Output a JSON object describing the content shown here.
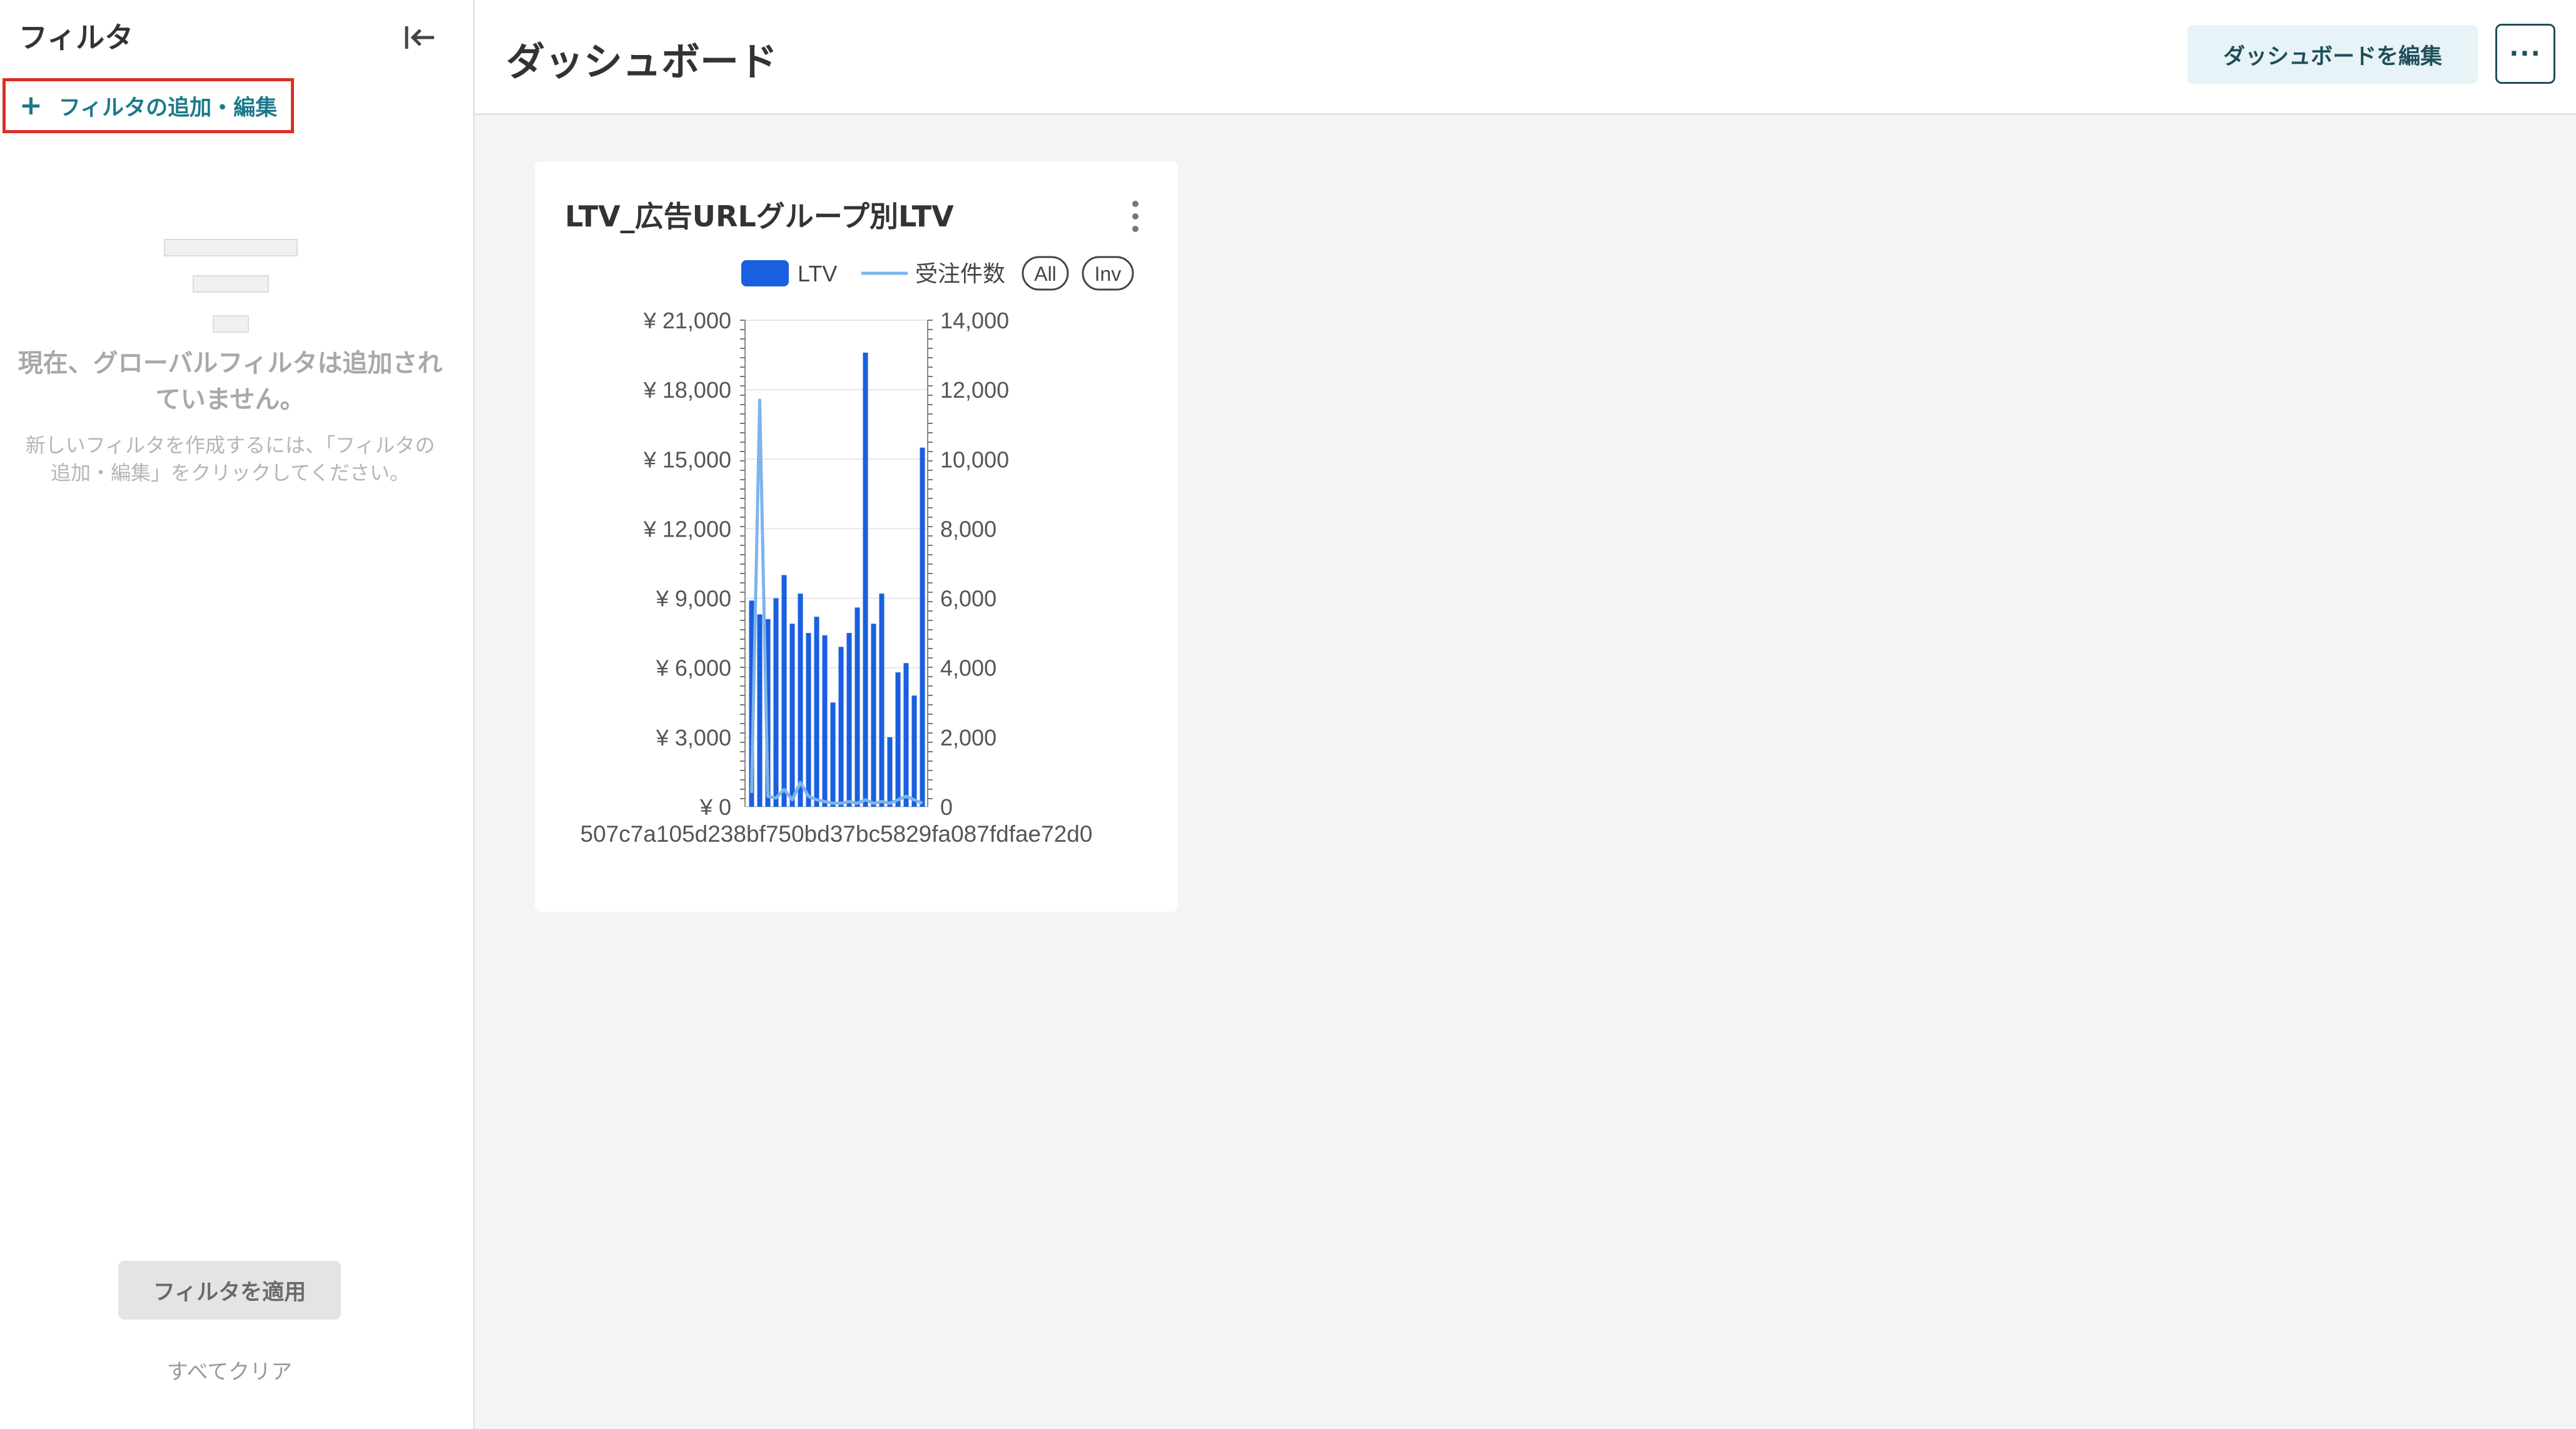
{
  "sidebar": {
    "title": "フィルタ",
    "add_filter_label": "フィルタの追加・編集",
    "empty_title": "現在、グローバルフィルタは追加されていません。",
    "empty_desc": "新しいフィルタを作成するには、「フィルタの追加・編集」をクリックしてください。",
    "apply_label": "フィルタを適用",
    "clear_label": "すべてクリア"
  },
  "header": {
    "title": "ダッシュボード",
    "edit_label": "ダッシュボードを編集",
    "more_label": "···"
  },
  "card": {
    "title": "LTV_広告URLグループ別LTV"
  },
  "colors": {
    "bar": "#1a5fe0",
    "line": "#7db4ea",
    "accent": "#1a7a8a"
  },
  "icons": [
    "collapse-sidebar-icon",
    "plus-icon",
    "kebab-menu-icon",
    "more-icon"
  ],
  "chart_data": {
    "type": "bar",
    "title": "LTV_広告URLグループ別LTV",
    "legend": [
      "LTV",
      "受注件数"
    ],
    "legend_buttons": [
      "All",
      "Inv"
    ],
    "legend_position": "top-right",
    "x_tick_label": "507c7a105d238bf750bd37bc5829fa087fdfae72d0",
    "y_left_ticks": [
      "¥ 0",
      "¥ 3,000",
      "¥ 6,000",
      "¥ 9,000",
      "¥ 12,000",
      "¥ 15,000",
      "¥ 18,000",
      "¥ 21,000"
    ],
    "y_right_ticks": [
      "0",
      "2,000",
      "4,000",
      "6,000",
      "8,000",
      "10,000",
      "12,000",
      "14,000"
    ],
    "ylim_left": [
      0,
      21000
    ],
    "ylim_right": [
      0,
      14000
    ],
    "grid": true,
    "series": [
      {
        "name": "LTV",
        "type": "bar",
        "axis": "left",
        "values": [
          8900,
          8300,
          8100,
          9000,
          10000,
          7900,
          9200,
          7500,
          8200,
          7400,
          4500,
          6900,
          7500,
          8600,
          19600,
          7900,
          9200,
          3000,
          5800,
          6200,
          4800,
          15500
        ]
      },
      {
        "name": "受注件数",
        "type": "line",
        "axis": "right",
        "values": [
          400,
          11700,
          300,
          250,
          500,
          200,
          700,
          300,
          200,
          150,
          100,
          100,
          150,
          100,
          200,
          100,
          150,
          100,
          200,
          300,
          200,
          100
        ]
      }
    ]
  }
}
